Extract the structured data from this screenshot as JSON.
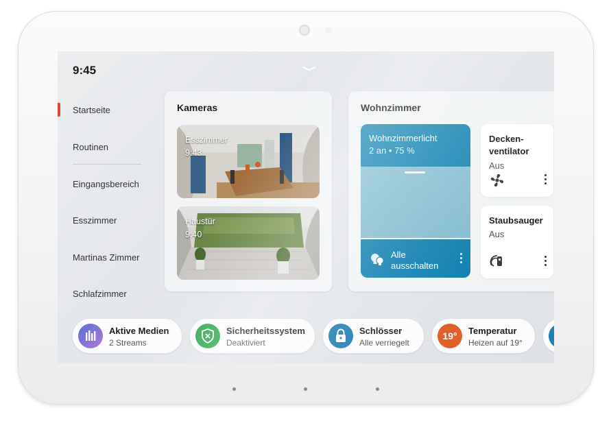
{
  "status": {
    "time": "9:45"
  },
  "nav": {
    "items": [
      {
        "label": "Startseite",
        "active": true
      },
      {
        "label": "Routinen"
      },
      {
        "label": "Eingangsbereich"
      },
      {
        "label": "Esszimmer"
      },
      {
        "label": "Martinas Zimmer"
      },
      {
        "label": "Schlafzimmer"
      }
    ]
  },
  "cameras": {
    "title": "Kameras",
    "feeds": [
      {
        "name": "Esszimmer",
        "time": "9:43"
      },
      {
        "name": "Haustür",
        "time": "9:40"
      }
    ]
  },
  "room": {
    "title": "Wohnzimmer",
    "light": {
      "name": "Wohnzimmerlicht",
      "status": "2 an • 75 %",
      "brightness_percent": 75,
      "action_line1": "Alle",
      "action_line2": "ausschalten"
    },
    "devices": [
      {
        "name_line1": "Decken-",
        "name_line2": "ventilator",
        "status": "Aus",
        "icon": "fan-icon"
      },
      {
        "name_line1": "Staubsauger",
        "status": "Aus",
        "icon": "robot-vacuum-icon"
      }
    ]
  },
  "chips": [
    {
      "title": "Aktive Medien",
      "subtitle": "2 Streams",
      "icon": "media-bars-icon",
      "color": "#8e6fd6"
    },
    {
      "title": "Sicherheitssystem",
      "subtitle": "Deaktiviert",
      "icon": "shield-icon",
      "color": "#2aa64a"
    },
    {
      "title": "Schlösser",
      "subtitle": "Alle verriegelt",
      "icon": "lock-icon",
      "color": "#1f7fb3"
    },
    {
      "title": "Temperatur",
      "subtitle": "Heizen auf 19°",
      "badge": "19°",
      "icon": "thermostat-icon",
      "color": "#e0602a"
    }
  ],
  "colors": {
    "accent": "#e0443c",
    "light_tile": "#1c88b5",
    "screen_bg": "#e6e9ec"
  }
}
